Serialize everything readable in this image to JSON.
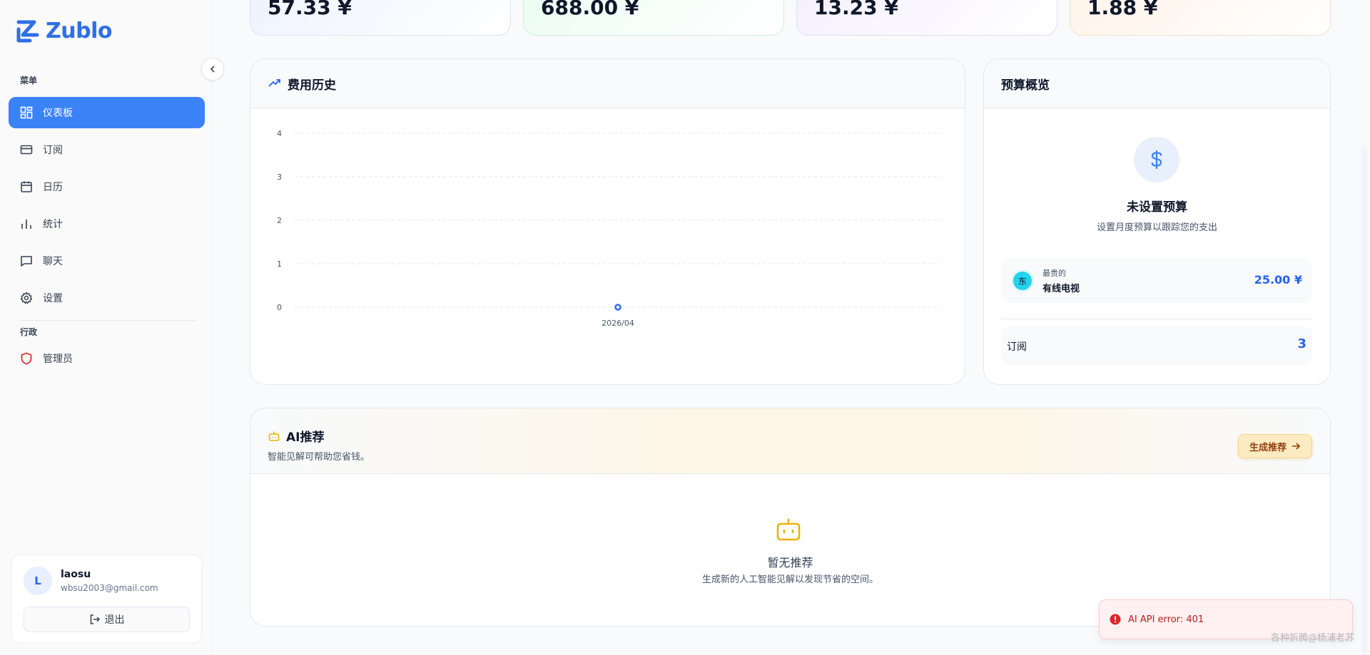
{
  "app": {
    "name": "Zublo"
  },
  "sidebar": {
    "menu_label": "菜单",
    "items": [
      {
        "label": "仪表板",
        "icon": "dashboard-icon"
      },
      {
        "label": "订阅",
        "icon": "credit-card-icon"
      },
      {
        "label": "日历",
        "icon": "calendar-icon"
      },
      {
        "label": "统计",
        "icon": "bar-chart-icon"
      },
      {
        "label": "聊天",
        "icon": "chat-icon"
      },
      {
        "label": "设置",
        "icon": "gear-icon"
      }
    ],
    "admin_label": "行政",
    "admin_item": {
      "label": "管理员",
      "icon": "shield-icon"
    }
  },
  "user": {
    "initial": "L",
    "name": "laosu",
    "email": "wbsu2003@gmail.com",
    "logout_label": "退出"
  },
  "stats": [
    {
      "value": "57.33 ¥"
    },
    {
      "value": "688.00 ¥"
    },
    {
      "value": "13.23 ¥"
    },
    {
      "value": "1.88 ¥"
    }
  ],
  "history": {
    "title": "费用历史"
  },
  "chart_data": {
    "type": "line",
    "title": "",
    "x": [
      "2026/04"
    ],
    "series": [
      {
        "values": [
          0
        ]
      }
    ],
    "yticks": [
      "0",
      "1",
      "2",
      "3",
      "4"
    ],
    "ylim": [
      0,
      4
    ],
    "grid": true,
    "point_color": "#2f6fe4"
  },
  "budget": {
    "title": "预算概览",
    "empty_title": "未设置预算",
    "empty_sub": "设置月度预算以跟踪您的支出",
    "most_expensive_label": "最贵的",
    "service_logo_text": "东",
    "service_name": "有线电视",
    "service_price": "25.00 ¥",
    "subs_label": "订阅",
    "subs_count": "3"
  },
  "ai": {
    "title": "AI推荐",
    "subtitle": "智能见解可帮助您省钱。",
    "generate_label": "生成推荐",
    "empty_title": "暂无推荐",
    "empty_sub": "生成新的人工智能见解以发现节省的空间。"
  },
  "toast": {
    "message": "AI API error: 401"
  },
  "watermark": "各种折腾@杨浦老苏",
  "colors": {
    "accent": "#3b82f6",
    "amber": "#eab308",
    "danger": "#dc2626"
  }
}
